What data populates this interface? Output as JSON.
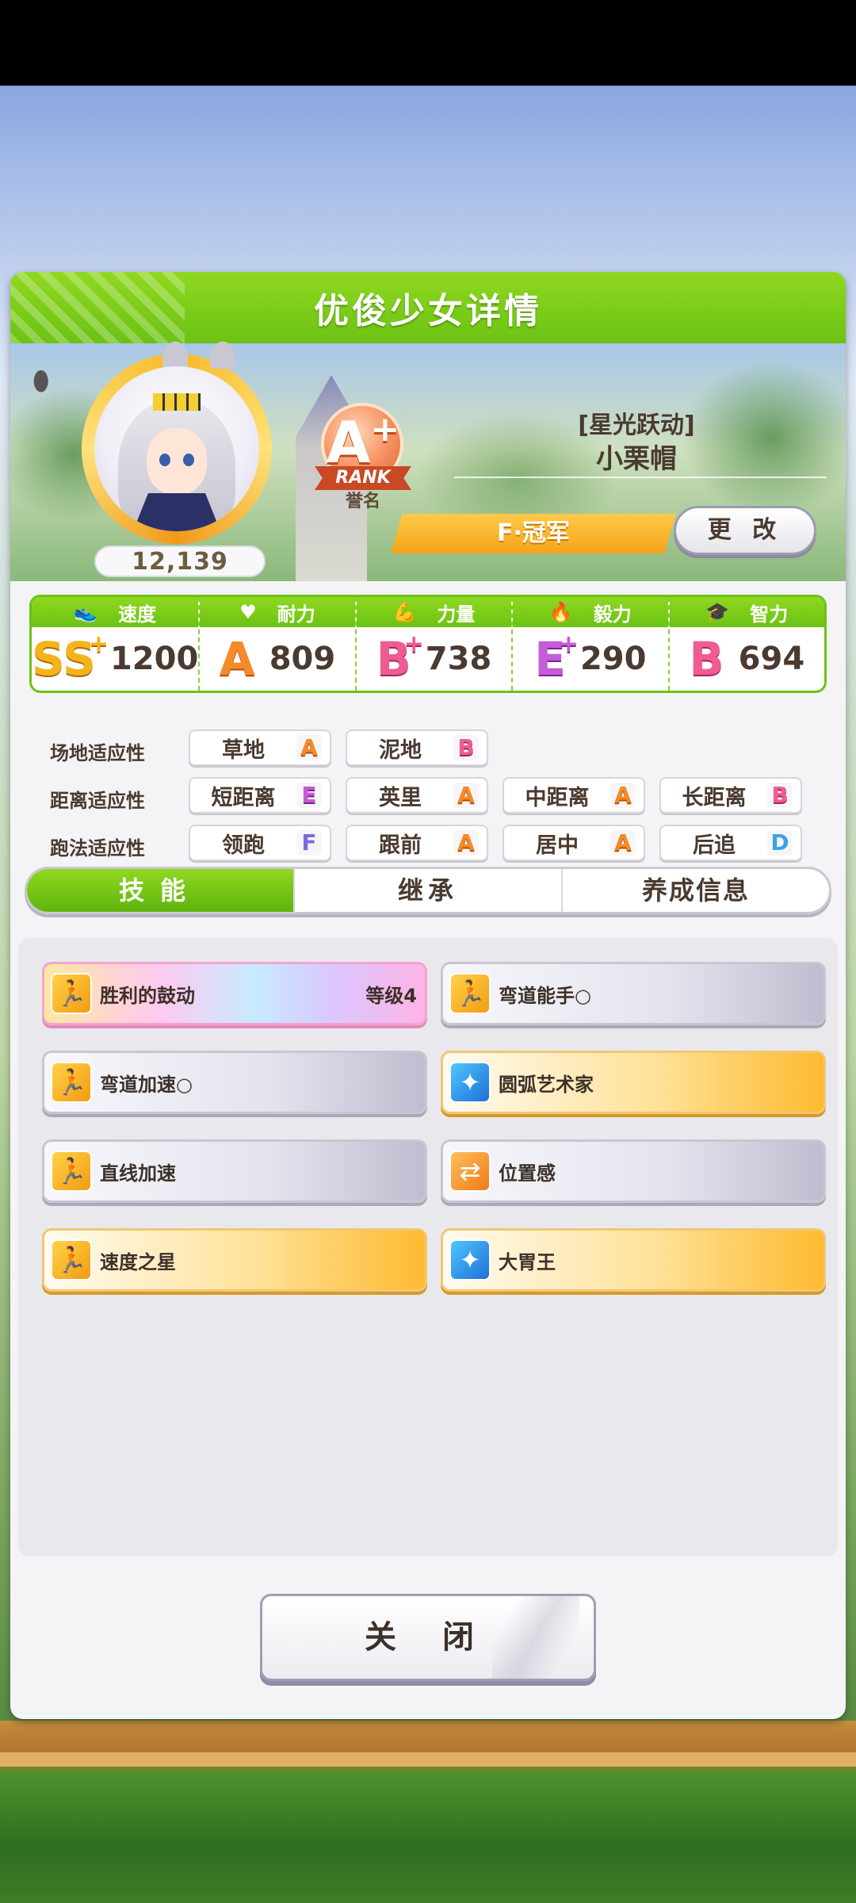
{
  "header": {
    "title": "优俊少女详情"
  },
  "profile": {
    "fans": "12,139",
    "rank": {
      "grade": "A",
      "plus": "+",
      "ribbon": "RANK",
      "caption": "誉名"
    },
    "epithet": "[星光跃动]",
    "name": "小栗帽",
    "title": "F·冠军",
    "change_label": "更 改"
  },
  "stats": [
    {
      "label": "速度",
      "icon": "shoe-icon",
      "glyph": "👟",
      "grade": "SS",
      "plus": "+",
      "value": "1200",
      "color": "#f2b41a"
    },
    {
      "label": "耐力",
      "icon": "heart-icon",
      "glyph": "♥",
      "grade": "A",
      "plus": "",
      "value": "809",
      "color": "#f58a28"
    },
    {
      "label": "力量",
      "icon": "muscle-icon",
      "glyph": "💪",
      "grade": "B",
      "plus": "+",
      "value": "738",
      "color": "#ef5c93"
    },
    {
      "label": "毅力",
      "icon": "flame-icon",
      "glyph": "🔥",
      "grade": "E",
      "plus": "+",
      "value": "290",
      "color": "#c35cd6"
    },
    {
      "label": "智力",
      "icon": "graduation-cap-icon",
      "glyph": "🎓",
      "grade": "B",
      "plus": "",
      "value": "694",
      "color": "#ef5c93"
    }
  ],
  "aptitudes": {
    "track": {
      "label": "场地适应性",
      "items": [
        {
          "name": "草地",
          "grade": "A"
        },
        {
          "name": "泥地",
          "grade": "B"
        }
      ]
    },
    "distance": {
      "label": "距离适应性",
      "items": [
        {
          "name": "短距离",
          "grade": "E"
        },
        {
          "name": "英里",
          "grade": "A"
        },
        {
          "name": "中距离",
          "grade": "A"
        },
        {
          "name": "长距离",
          "grade": "B"
        }
      ]
    },
    "strategy": {
      "label": "跑法适应性",
      "items": [
        {
          "name": "领跑",
          "grade": "F"
        },
        {
          "name": "跟前",
          "grade": "A"
        },
        {
          "name": "居中",
          "grade": "A"
        },
        {
          "name": "后追",
          "grade": "D"
        }
      ]
    }
  },
  "tabs": [
    {
      "label": "技能",
      "active": true
    },
    {
      "label": "继承",
      "active": false
    },
    {
      "label": "养成信息",
      "active": false
    }
  ],
  "skills": [
    {
      "name": "胜利的鼓动",
      "level": "等级4",
      "style": "rainbow",
      "icon": "speed-icon"
    },
    {
      "name": "弯道能手○",
      "level": "",
      "style": "white",
      "icon": "speed-icon"
    },
    {
      "name": "弯道加速○",
      "level": "",
      "style": "white",
      "icon": "speed-icon"
    },
    {
      "name": "圆弧艺术家",
      "level": "",
      "style": "gold",
      "icon": "recovery-icon"
    },
    {
      "name": "直线加速",
      "level": "",
      "style": "white",
      "icon": "speed-icon"
    },
    {
      "name": "位置感",
      "level": "",
      "style": "white",
      "icon": "position-icon"
    },
    {
      "name": "速度之星",
      "level": "",
      "style": "gold",
      "icon": "speed-icon"
    },
    {
      "name": "大胃王",
      "level": "",
      "style": "gold",
      "icon": "recovery-icon"
    }
  ],
  "close_label": "关 闭",
  "colors": {
    "accent_green": "#6cc214",
    "grade_a": "#f58a28",
    "grade_b": "#ef5c93",
    "grade_e": "#c35cd6",
    "grade_ss": "#f2b41a",
    "grade_f": "#7a6ed6",
    "grade_d": "#3ba4e4"
  }
}
